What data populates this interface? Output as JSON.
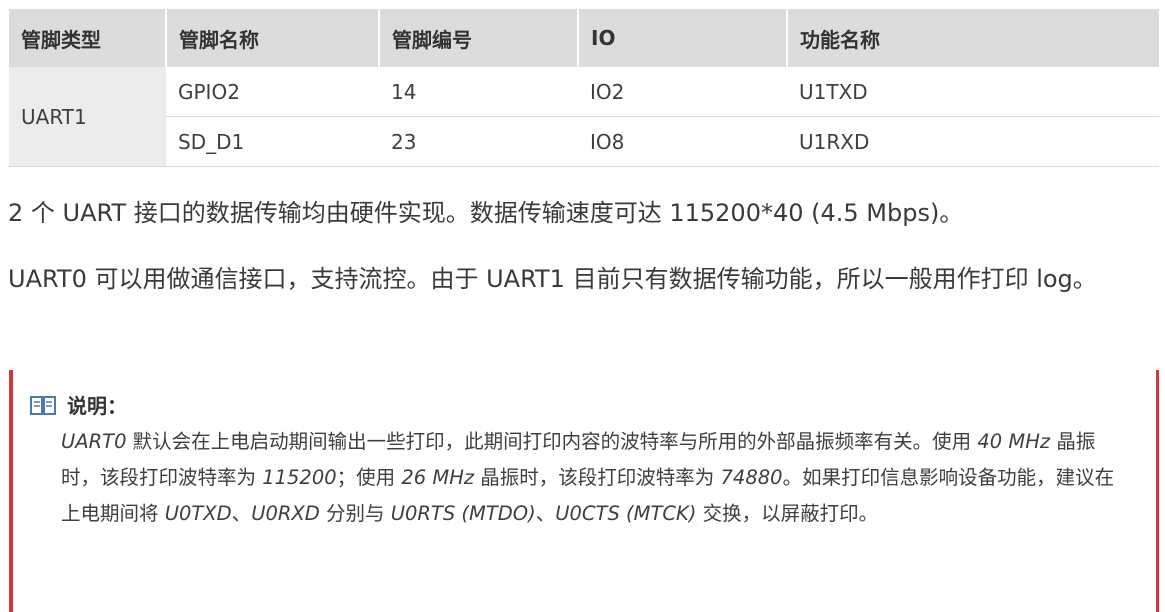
{
  "table": {
    "headers": [
      "管脚类型",
      "管脚名称",
      "管脚编号",
      "IO",
      "功能名称"
    ],
    "group_label": "UART1",
    "rows": [
      [
        "GPIO2",
        "14",
        "IO2",
        "U1TXD"
      ],
      [
        "SD_D1",
        "23",
        "IO8",
        "U1RXD"
      ]
    ]
  },
  "paragraphs": [
    "2 个 UART 接口的数据传输均由硬件实现。数据传输速度可达 115200*40 (4.5 Mbps)。",
    "UART0 可以用做通信接口，支持流控。由于 UART1 目前只有数据传输功能，所以一般用作打印 log。"
  ],
  "note": {
    "title": "说明：",
    "icon": "book-icon",
    "accent_color": "#d43737",
    "body": {
      "s1_uart0": "UART0",
      "s1_rest": " 默认会在上电启动期间输出一些打印，此期间打印内容的波特率与所用的外部晶振频率有关。使用 ",
      "s2_40mhz": "40 MHz",
      "s2_a": " 晶振时，该段打印波特率为 ",
      "s2_115200": "115200",
      "s2_b": "；使用 ",
      "s2_26mhz": "26 MHz",
      "s2_c": " 晶振时，该段打印波特率为 ",
      "s2_74880": "74880",
      "s2_d": "。如果打印信息影响设备功能，建议在上电期间将 ",
      "s3_u0txd": "U0TXD",
      "s3_a": "、",
      "s3_u0rxd": "U0RXD",
      "s3_b": " 分别与 ",
      "s3_u0rts": "U0RTS (MTDO)",
      "s3_c": "、",
      "s3_u0cts": "U0CTS (MTCK)",
      "s3_d": " 交换，以屏蔽打印。"
    }
  }
}
